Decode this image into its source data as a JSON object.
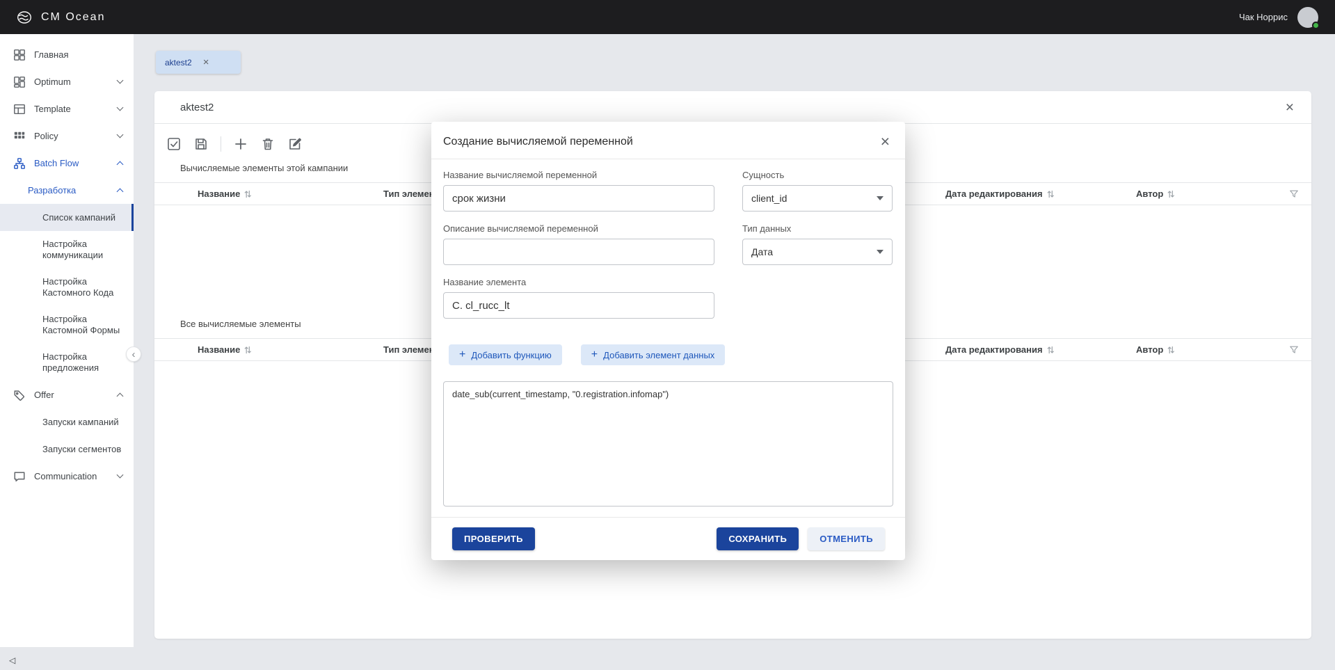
{
  "topbar": {
    "logo_text": "CM Ocean",
    "username": "Чак Норрис"
  },
  "sidebar": {
    "items": [
      {
        "label": "Главная"
      },
      {
        "label": "Optimum"
      },
      {
        "label": "Template"
      },
      {
        "label": "Policy"
      },
      {
        "label": "Batch Flow"
      },
      {
        "label": "Разработка"
      },
      {
        "label": "Список кампаний"
      },
      {
        "label": "Настройка коммуникации"
      },
      {
        "label": "Настройка Кастомного Кода"
      },
      {
        "label": "Настройка Кастомной Формы"
      },
      {
        "label": "Настройка предложения"
      },
      {
        "label": "Offer"
      },
      {
        "label": "Запуски кампаний"
      },
      {
        "label": "Запуски сегментов"
      },
      {
        "label": "Communication"
      }
    ]
  },
  "tab": {
    "label": "aktest2"
  },
  "panel": {
    "title": "aktest2",
    "section1_title": "Вычисляемые элементы этой кампании",
    "section2_title": "Все вычисляемые элементы",
    "table_headers": [
      "Название",
      "Тип элемент",
      "Дата редактирования",
      "Автор"
    ]
  },
  "modal": {
    "title": "Создание вычисляемой переменной",
    "name_label": "Название вычисляемой переменной",
    "name_value": "срок жизни",
    "entity_label": "Сущность",
    "entity_value": "client_id",
    "description_label": "Описание вычисляемой переменной",
    "description_value": "",
    "datatype_label": "Тип данных",
    "datatype_value": "Дата",
    "element_label": "Название элемента",
    "element_value": "C. cl_rucc_lt",
    "add_function_label": "Добавить функцию",
    "add_element_label": "Добавить элемент данных",
    "formula_value": "date_sub(current_timestamp, \"0.registration.infomap\")",
    "check_label": "ПРОВЕРИТЬ",
    "save_label": "СОХРАНИТЬ",
    "cancel_label": "ОТМЕНИТЬ"
  },
  "icons": {
    "close": "×",
    "plus": "+",
    "chevron_left": "‹",
    "triangle_left": "◁"
  },
  "colors": {
    "primary_blue": "#1b449c",
    "accent_blue": "#2a5bc4",
    "chip_bg": "#dce8f8",
    "tab_bg": "#cfdff3",
    "topbar_bg": "#1d1d1f",
    "status_green": "#43b649"
  }
}
